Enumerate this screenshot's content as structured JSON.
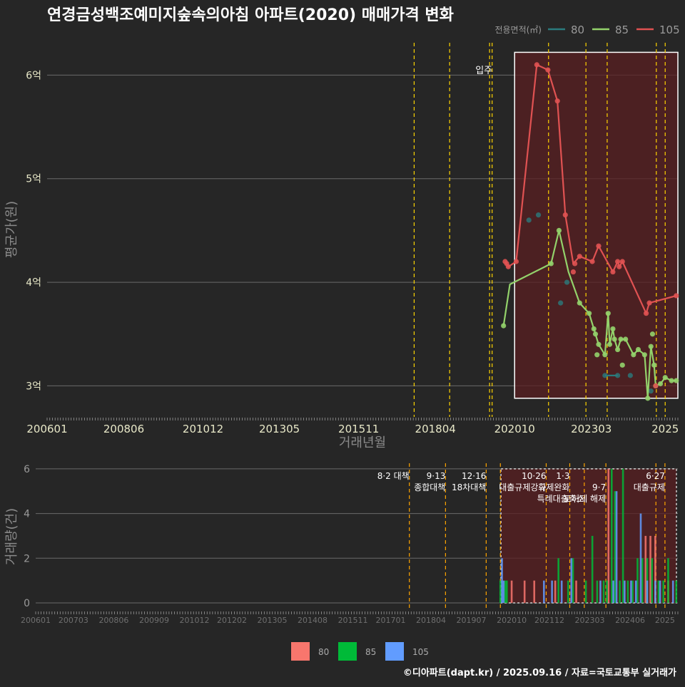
{
  "title": "연경금성백조예미지숲속의아침 아파트(2020) 매매가격 변화",
  "legend_top": {
    "label": "전용면적(㎡)",
    "items": [
      "80",
      "85",
      "105"
    ]
  },
  "legend_bottom": {
    "items": [
      "80",
      "85",
      "105"
    ]
  },
  "footer": "©디아파트(dapt.kr) / 2025.09.16 / 자료=국토교통부 실거래가",
  "colors": {
    "background": "#262626",
    "s80_top": "#2a7b7d",
    "s85_top": "#93d26b",
    "s105_top": "#e05252",
    "s80_bottom": "#f8766d",
    "s85_bottom": "#00ba38",
    "s105_bottom": "#619cff",
    "policy_line": "#ffd400",
    "highlight_fill": "#5a1f22"
  },
  "annotation": "입주",
  "chart_data": [
    {
      "type": "line",
      "ylabel": "평균가(원)",
      "xlabel": "거래년월",
      "y_ticks": [
        {
          "v": 3,
          "label": "3억"
        },
        {
          "v": 4,
          "label": "4억"
        },
        {
          "v": 5,
          "label": "5억"
        },
        {
          "v": 6,
          "label": "6억"
        }
      ],
      "ylim": [
        2.7,
        6.45
      ],
      "x_ticks": [
        "200601",
        "200806",
        "201012",
        "201305",
        "201511",
        "201804",
        "202010",
        "202303",
        "2025"
      ],
      "x_tick_values": [
        2006.0,
        2008.42,
        2010.92,
        2013.33,
        2015.83,
        2018.25,
        2020.75,
        2023.17,
        2025.5
      ],
      "xlim": [
        2006.0,
        2025.9
      ],
      "policy_dates": [
        2017.58,
        2018.7,
        2019.96,
        2020.04,
        2021.82,
        2023.0,
        2023.67,
        2025.22,
        2025.5
      ],
      "highlight": {
        "x0": 2020.75,
        "x1": 2025.9,
        "y0": 2.88,
        "y1": 6.22
      },
      "annotation_x": 2019.96,
      "series": [
        {
          "name": "80",
          "points": [
            [
              2021.2,
              4.6
            ],
            [
              2021.5,
              4.65
            ],
            [
              2022.2,
              3.8
            ],
            [
              2022.4,
              4.0
            ],
            [
              2023.6,
              3.1
            ],
            [
              2024.0,
              3.1
            ],
            [
              2024.4,
              3.1
            ],
            [
              2025.05,
              2.95
            ]
          ],
          "line": [
            [
              2023.6,
              3.1
            ],
            [
              2024.0,
              3.1
            ]
          ]
        },
        {
          "name": "85",
          "points": [
            [
              2020.4,
              3.58
            ],
            [
              2021.9,
              4.18
            ],
            [
              2022.15,
              4.5
            ],
            [
              2022.8,
              3.8
            ],
            [
              2023.1,
              3.7
            ],
            [
              2023.25,
              3.55
            ],
            [
              2023.3,
              3.5
            ],
            [
              2023.35,
              3.3
            ],
            [
              2023.4,
              3.4
            ],
            [
              2023.6,
              3.3
            ],
            [
              2023.7,
              3.7
            ],
            [
              2023.75,
              3.4
            ],
            [
              2023.85,
              3.55
            ],
            [
              2023.9,
              3.45
            ],
            [
              2024.0,
              3.35
            ],
            [
              2024.1,
              3.45
            ],
            [
              2024.15,
              3.2
            ],
            [
              2024.25,
              3.45
            ],
            [
              2024.5,
              3.3
            ],
            [
              2024.65,
              3.35
            ],
            [
              2024.85,
              3.3
            ],
            [
              2024.95,
              2.88
            ],
            [
              2025.05,
              3.38
            ],
            [
              2025.1,
              3.5
            ],
            [
              2025.15,
              3.2
            ],
            [
              2025.2,
              3.0
            ],
            [
              2025.35,
              3.02
            ],
            [
              2025.5,
              3.08
            ],
            [
              2025.7,
              3.05
            ],
            [
              2025.85,
              3.05
            ]
          ],
          "line": [
            [
              2020.4,
              3.58
            ],
            [
              2020.6,
              3.98
            ],
            [
              2021.9,
              4.18
            ],
            [
              2022.15,
              4.5
            ],
            [
              2022.45,
              4.1
            ],
            [
              2022.8,
              3.8
            ],
            [
              2023.1,
              3.7
            ],
            [
              2023.25,
              3.55
            ],
            [
              2023.4,
              3.4
            ],
            [
              2023.6,
              3.3
            ],
            [
              2023.7,
              3.7
            ],
            [
              2023.75,
              3.4
            ],
            [
              2023.85,
              3.55
            ],
            [
              2023.9,
              3.45
            ],
            [
              2024.0,
              3.35
            ],
            [
              2024.1,
              3.45
            ],
            [
              2024.25,
              3.45
            ],
            [
              2024.5,
              3.3
            ],
            [
              2024.65,
              3.35
            ],
            [
              2024.85,
              3.3
            ],
            [
              2024.95,
              2.88
            ],
            [
              2025.05,
              3.38
            ],
            [
              2025.15,
              3.2
            ],
            [
              2025.2,
              3.0
            ],
            [
              2025.35,
              3.02
            ],
            [
              2025.5,
              3.08
            ],
            [
              2025.7,
              3.05
            ],
            [
              2025.85,
              3.05
            ]
          ]
        },
        {
          "name": "105",
          "points": [
            [
              2020.45,
              4.2
            ],
            [
              2020.5,
              4.18
            ],
            [
              2020.55,
              4.15
            ],
            [
              2020.8,
              4.2
            ],
            [
              2021.45,
              6.1
            ],
            [
              2021.8,
              6.05
            ],
            [
              2022.1,
              5.75
            ],
            [
              2022.35,
              4.65
            ],
            [
              2022.6,
              4.1
            ],
            [
              2022.65,
              4.18
            ],
            [
              2022.8,
              4.25
            ],
            [
              2023.2,
              4.2
            ],
            [
              2023.4,
              4.35
            ],
            [
              2023.85,
              4.1
            ],
            [
              2024.0,
              4.2
            ],
            [
              2024.05,
              4.15
            ],
            [
              2024.15,
              4.2
            ],
            [
              2024.9,
              3.7
            ],
            [
              2025.0,
              3.8
            ],
            [
              2025.2,
              3.0
            ],
            [
              2025.85,
              3.87
            ]
          ],
          "line": [
            [
              2020.45,
              4.2
            ],
            [
              2020.55,
              4.15
            ],
            [
              2020.8,
              4.2
            ],
            [
              2021.45,
              6.1
            ],
            [
              2021.8,
              6.05
            ],
            [
              2022.1,
              5.75
            ],
            [
              2022.35,
              4.65
            ],
            [
              2022.6,
              4.18
            ],
            [
              2022.8,
              4.25
            ],
            [
              2023.2,
              4.2
            ],
            [
              2023.4,
              4.35
            ],
            [
              2023.85,
              4.1
            ],
            [
              2024.0,
              4.2
            ],
            [
              2024.05,
              4.15
            ],
            [
              2024.15,
              4.2
            ],
            [
              2024.9,
              3.7
            ],
            [
              2025.0,
              3.8
            ],
            [
              2025.85,
              3.87
            ]
          ]
        }
      ]
    },
    {
      "type": "bar",
      "ylabel": "거래량(건)",
      "y_ticks": [
        0,
        2,
        4,
        6
      ],
      "ylim": [
        -0.35,
        6.25
      ],
      "x_ticks": [
        "200601",
        "200703",
        "200806",
        "200909",
        "201012",
        "201202",
        "201305",
        "201408",
        "201511",
        "201701",
        "201804",
        "201907",
        "202010",
        "202112",
        "202303",
        "202406",
        "2025"
      ],
      "x_tick_values": [
        2006.0,
        2007.17,
        2008.42,
        2009.67,
        2010.92,
        2012.08,
        2013.33,
        2014.58,
        2015.83,
        2017.0,
        2018.25,
        2019.5,
        2020.75,
        2021.92,
        2023.17,
        2024.42,
        2025.5
      ],
      "xlim": [
        2006.0,
        2025.9
      ],
      "policy_dates": [
        2017.58,
        2018.7,
        2019.96,
        2020.4,
        2021.82,
        2022.55,
        2023.0,
        2023.67,
        2025.22,
        2025.5
      ],
      "highlight": {
        "x0": 2020.75,
        "x1": 2025.9,
        "y0": 0,
        "y1": 6.0
      },
      "policy_labels": [
        {
          "x": 2017.58,
          "lines": [
            "8·2 대책"
          ]
        },
        {
          "x": 2018.7,
          "lines": [
            "9·13",
            "종합대책"
          ]
        },
        {
          "x": 2019.96,
          "lines": [
            "12·16",
            "18차대책"
          ]
        },
        {
          "x": 2021.82,
          "lines": [
            "10·26",
            "대출규제강화"
          ]
        },
        {
          "x": 2022.55,
          "lines": [
            "1·3",
            "규제완화"
          ]
        },
        {
          "x": 2023.0,
          "lines": [
            "",
            "",
            "특례대출축소"
          ]
        },
        {
          "x": 2023.67,
          "lines": [
            "",
            "9·7",
            "토허제 해제"
          ]
        },
        {
          "x": 2025.5,
          "lines": [
            "6·27",
            "대출규제"
          ]
        }
      ],
      "series": [
        {
          "name": "80",
          "bars": [
            [
              2020.75,
              1
            ],
            [
              2021.15,
              1
            ],
            [
              2021.45,
              1
            ],
            [
              2022.1,
              1
            ],
            [
              2022.75,
              1
            ],
            [
              2023.75,
              6
            ],
            [
              2024.9,
              3
            ],
            [
              2025.05,
              3
            ],
            [
              2025.2,
              3
            ],
            [
              2025.6,
              1
            ]
          ]
        },
        {
          "name": "85",
          "bars": [
            [
              2020.4,
              1
            ],
            [
              2020.55,
              1
            ],
            [
              2020.6,
              1
            ],
            [
              2022.2,
              2
            ],
            [
              2022.5,
              1
            ],
            [
              2022.65,
              2
            ],
            [
              2023.05,
              1
            ],
            [
              2023.25,
              3
            ],
            [
              2023.4,
              1
            ],
            [
              2023.6,
              1
            ],
            [
              2023.7,
              1
            ],
            [
              2023.85,
              6
            ],
            [
              2023.95,
              5
            ],
            [
              2024.1,
              1
            ],
            [
              2024.2,
              6
            ],
            [
              2024.35,
              1
            ],
            [
              2024.5,
              1
            ],
            [
              2024.65,
              2
            ],
            [
              2024.8,
              2
            ],
            [
              2024.95,
              2
            ],
            [
              2025.1,
              2
            ],
            [
              2025.3,
              1
            ],
            [
              2025.45,
              1
            ],
            [
              2025.6,
              2
            ],
            [
              2025.85,
              1
            ]
          ]
        },
        {
          "name": "105",
          "bars": [
            [
              2020.45,
              2
            ],
            [
              2020.5,
              1
            ],
            [
              2021.75,
              1
            ],
            [
              2022.0,
              1
            ],
            [
              2022.3,
              1
            ],
            [
              2022.6,
              2
            ],
            [
              2023.5,
              1
            ],
            [
              2023.9,
              1
            ],
            [
              2024.0,
              5
            ],
            [
              2024.25,
              1
            ],
            [
              2024.45,
              1
            ],
            [
              2024.6,
              1
            ],
            [
              2024.75,
              4
            ],
            [
              2024.95,
              1
            ],
            [
              2025.2,
              1
            ],
            [
              2025.35,
              1
            ],
            [
              2025.75,
              1
            ]
          ]
        }
      ]
    }
  ]
}
